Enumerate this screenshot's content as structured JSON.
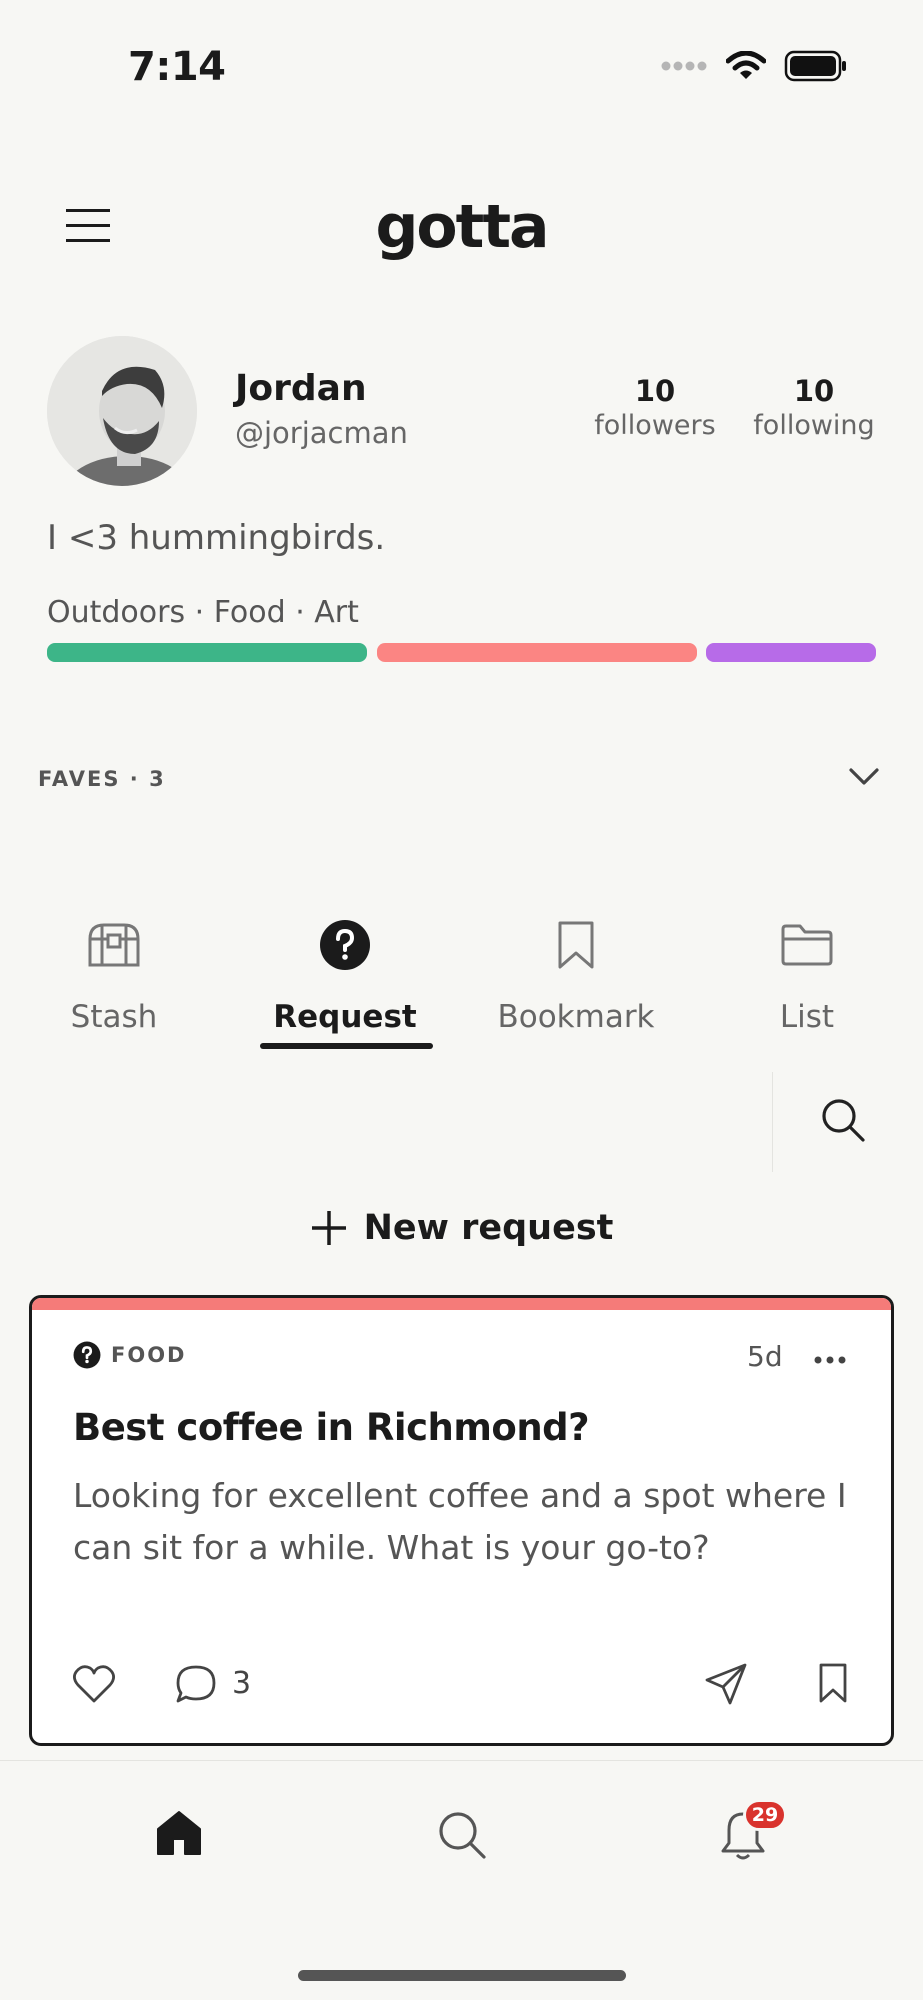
{
  "status_bar": {
    "time": "7:14"
  },
  "header": {
    "logo": "gotta"
  },
  "profile": {
    "name": "Jordan",
    "handle": "@jorjacman",
    "followers_count": "10",
    "followers_label": "followers",
    "following_count": "10",
    "following_label": "following",
    "bio": "I <3 hummingbirds.",
    "tags_text": "Outdoors · Food · Art",
    "tag_colors": {
      "outdoors": "#3db588",
      "food": "#fb8583",
      "art": "#b76be8"
    }
  },
  "faves": {
    "label": "FAVES · 3"
  },
  "tabs": [
    {
      "label": "Stash",
      "icon": "treasure-chest-icon"
    },
    {
      "label": "Request",
      "icon": "question-circle-icon"
    },
    {
      "label": "Bookmark",
      "icon": "bookmark-icon"
    },
    {
      "label": "List",
      "icon": "folder-icon"
    }
  ],
  "active_tab": "Request",
  "new_request_label": "New request",
  "request_card": {
    "category": "FOOD",
    "age": "5d",
    "title": "Best coffee in Richmond?",
    "body": "Looking for excellent coffee and a spot where I can sit for a while. What is your go-to?",
    "comment_count": "3",
    "accent_color": "#f57b79"
  },
  "bottom_nav": {
    "notifications_badge": "29"
  }
}
